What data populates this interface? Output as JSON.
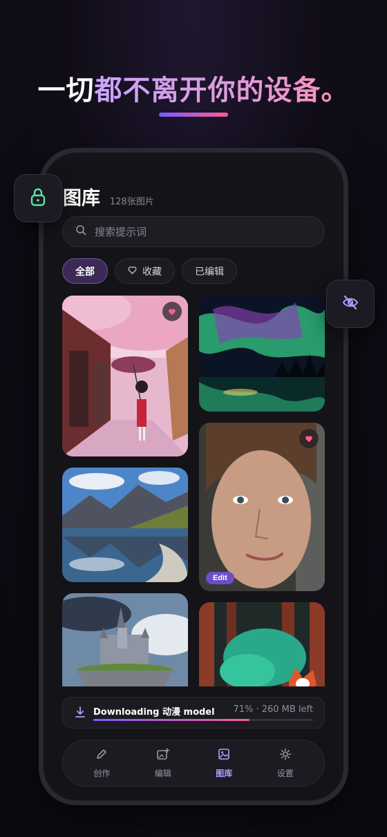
{
  "headline": {
    "part1": "一切",
    "part2": "都不离开你的设备。"
  },
  "gallery": {
    "title": "图库",
    "count": "128张图片"
  },
  "search": {
    "placeholder": "搜索提示词"
  },
  "filters": [
    {
      "label": "全部",
      "active": true
    },
    {
      "label": "收藏",
      "icon": "heart-outline-icon"
    },
    {
      "label": "已编辑"
    }
  ],
  "tiles": [
    {
      "subject": "anime girl with umbrella under cherry blossoms",
      "favorite": true
    },
    {
      "subject": "aurora over lake"
    },
    {
      "subject": "mountain lake reflection"
    },
    {
      "subject": "portrait of young woman",
      "favorite": true,
      "badge": "Edit"
    },
    {
      "subject": "floating castle"
    },
    {
      "subject": "red fox in forest"
    }
  ],
  "download": {
    "label": "Downloading 动漫 model",
    "status": "71% · 260 MB left",
    "progress": 0.71
  },
  "nav": [
    {
      "label": "创作",
      "icon": "pencil-icon"
    },
    {
      "label": "编辑",
      "icon": "image-edit-icon"
    },
    {
      "label": "图库",
      "icon": "gallery-icon",
      "active": true
    },
    {
      "label": "设置",
      "icon": "gear-icon"
    }
  ],
  "colors": {
    "accent": "#b79bff",
    "gradient_start": "#7b5cff",
    "gradient_end": "#ff5c9a",
    "lock_green": "#5ee3a1"
  },
  "badges": {
    "lock": "lock-icon",
    "privacy": "eye-off-icon"
  }
}
